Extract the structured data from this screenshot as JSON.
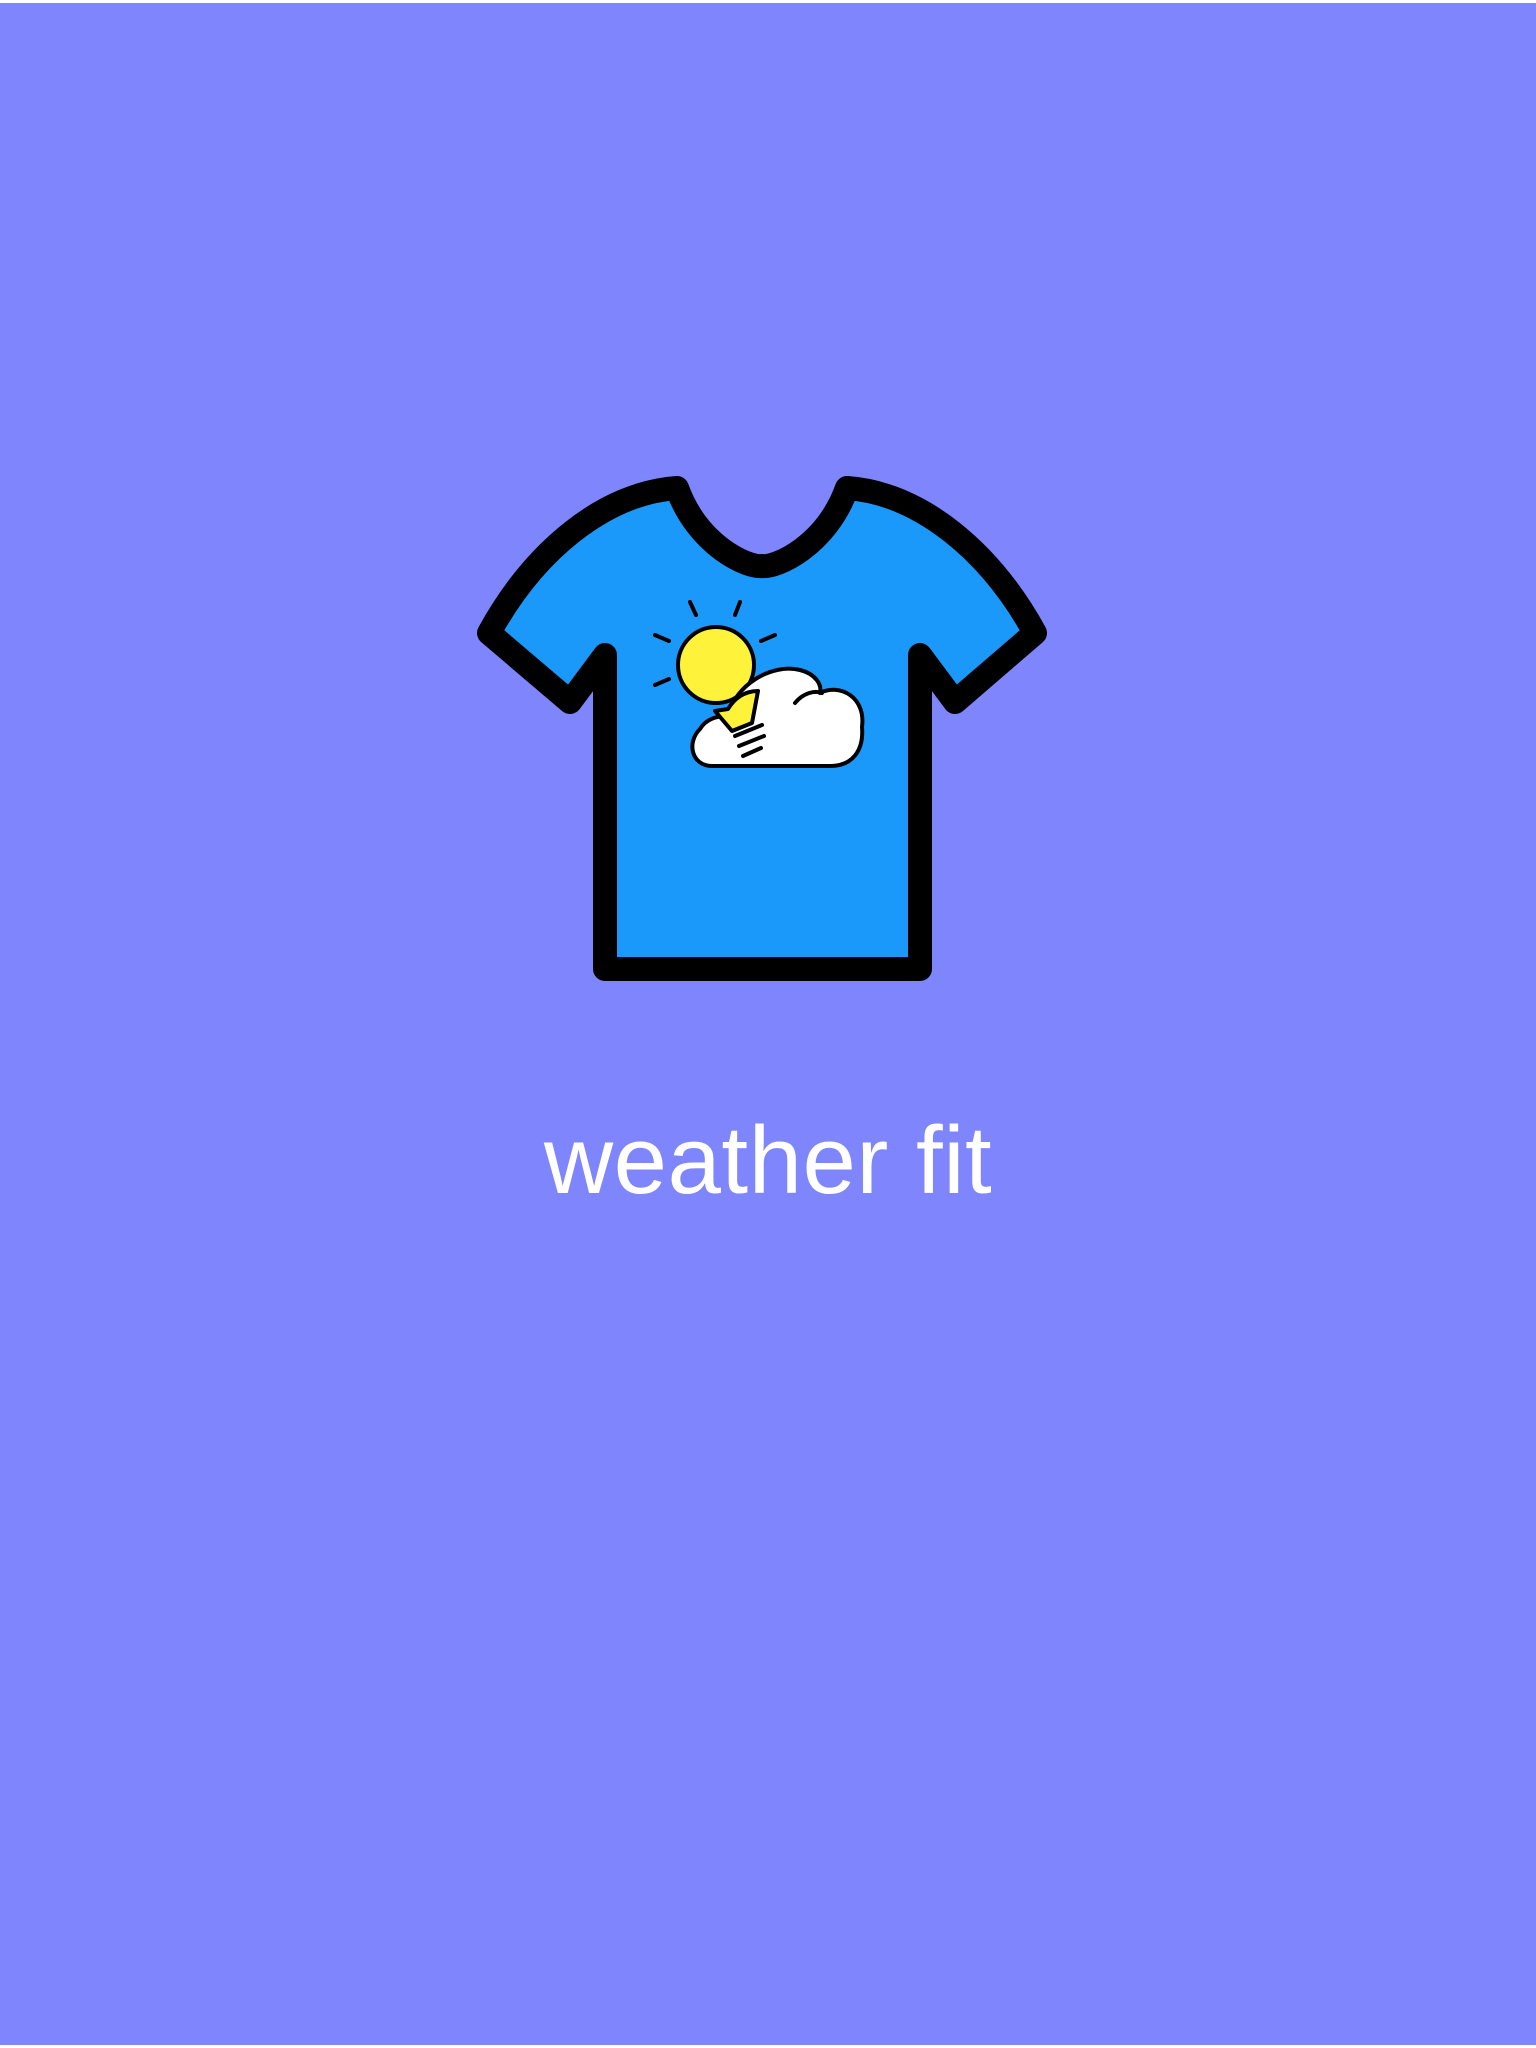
{
  "splash": {
    "app_name": "weather fit",
    "logo_icon": "tshirt-weather-icon",
    "sun_icon": "sun-lightbulb-icon",
    "cloud_icon": "cloud-icon"
  },
  "colors": {
    "background": "#7f85fc",
    "shirt": "#1b99fb",
    "outline": "#000000",
    "sun": "#fef33a",
    "cloud": "#ffffff",
    "title_text": "#ffffff"
  }
}
